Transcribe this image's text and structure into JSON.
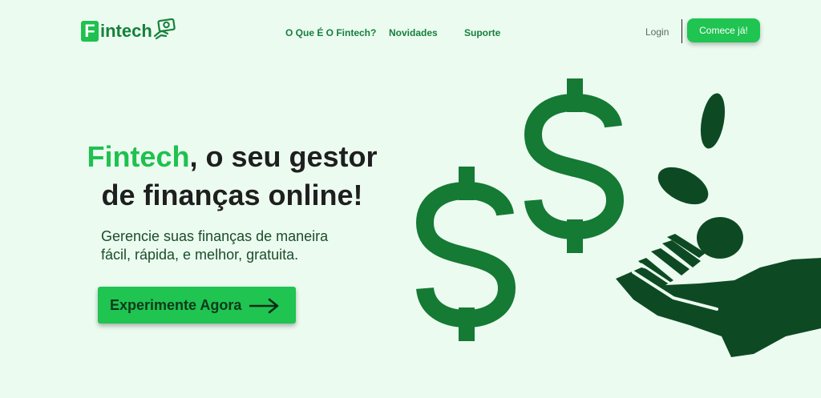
{
  "header": {
    "logo": {
      "letter": "F",
      "text": "intech",
      "icon": "money-hand-icon"
    },
    "nav": [
      {
        "label": "O Que É O Fintech?"
      },
      {
        "label": "Novidades"
      },
      {
        "label": "Suporte"
      }
    ],
    "login_label": "Login",
    "cta_label": "Comece já!"
  },
  "hero": {
    "title_accent": "Fintech",
    "title_rest_line1": ", o seu gestor",
    "title_line2": "de finanças online!",
    "subtitle_line1": "Gerencie suas finanças de maneira",
    "subtitle_line2": "fácil, rápida, e melhor, gratuita.",
    "cta_label": "Experimente Agora",
    "cta_icon": "arrow-right-icon"
  },
  "illustration": {
    "dollar_symbol": "$",
    "icons": [
      "dollar-sign-icon",
      "coin-icon",
      "hand-icon"
    ]
  },
  "colors": {
    "background": "#ecfbf0",
    "brand_green": "#1fc14f",
    "dark_green": "#0d4a23",
    "dollar_green": "#147a34"
  }
}
